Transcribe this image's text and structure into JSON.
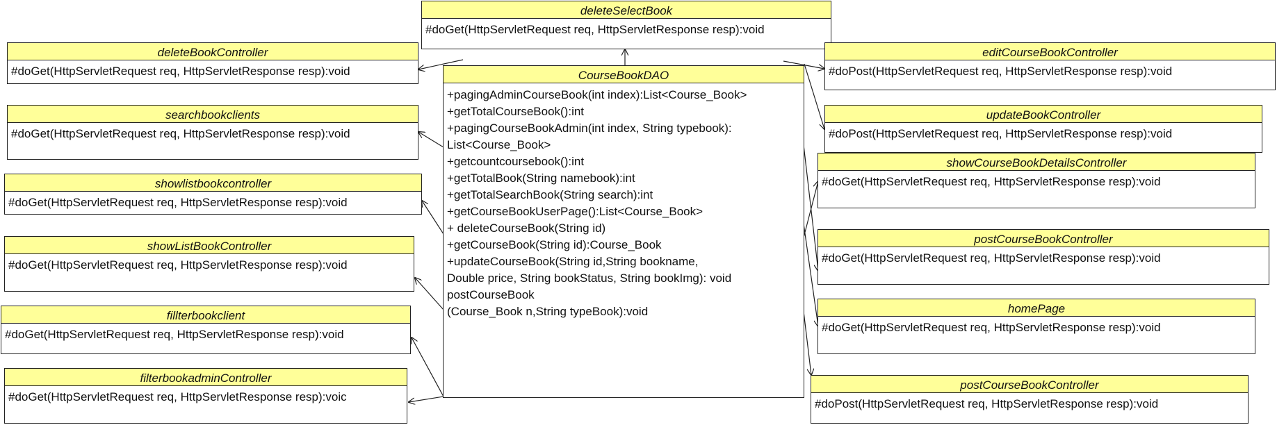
{
  "center": {
    "name": "CourseBookDAO",
    "members": [
      "+pagingAdminCourseBook(int index):List<Course_Book>",
      "+getTotalCourseBook():int",
      "+pagingCourseBookAdmin(int index, String typebook):",
      "List<Course_Book>",
      "+getcountcoursebook():int",
      "+getTotalBook(String namebook):int",
      "+getTotalSearchBook(String search):int",
      "+getCourseBookUserPage():List<Course_Book>",
      "+ deleteCourseBook(String id)",
      "+getCourseBook(String id):Course_Book",
      "+updateCourseBook(String id,String bookname,",
      "Double price, String bookStatus, String bookImg): void",
      "postCourseBook",
      "(Course_Book n,String typeBook):void"
    ]
  },
  "top": {
    "name": "deleteSelectBook",
    "method": "#doGet(HttpServletRequest req, HttpServletResponse resp):void"
  },
  "left": [
    {
      "name": "deleteBookController",
      "method": "#doGet(HttpServletRequest req, HttpServletResponse resp):void"
    },
    {
      "name": "searchbookclients",
      "method": "#doGet(HttpServletRequest req, HttpServletResponse resp):void"
    },
    {
      "name": "showlistbookcontroller",
      "method": "#doGet(HttpServletRequest req, HttpServletResponse resp):void"
    },
    {
      "name": "showListBookController",
      "method": "#doGet(HttpServletRequest req, HttpServletResponse resp):void"
    },
    {
      "name": "fillterbookclient",
      "method": "#doGet(HttpServletRequest req, HttpServletResponse resp):void"
    },
    {
      "name": "filterbookadminController",
      "method": "#doGet(HttpServletRequest req, HttpServletResponse resp):voic"
    }
  ],
  "right": [
    {
      "name": "editCourseBookController",
      "method": "#doPost(HttpServletRequest req, HttpServletResponse resp):void"
    },
    {
      "name": "updateBookController",
      "method": "#doPost(HttpServletRequest req, HttpServletResponse resp):void"
    },
    {
      "name": "showCourseBookDetailsController",
      "method": "#doGet(HttpServletRequest req, HttpServletResponse resp):void"
    },
    {
      "name": "postCourseBookController",
      "method": "#doGet(HttpServletRequest req, HttpServletResponse resp):void"
    },
    {
      "name": "homePage",
      "method": "#doGet(HttpServletRequest req, HttpServletResponse resp):void"
    },
    {
      "name": "postCourseBookController",
      "method": "#doPost(HttpServletRequest req, HttpServletResponse resp):void"
    }
  ],
  "colors": {
    "header": "#ffff99",
    "border": "#222222",
    "line": "#222222"
  }
}
